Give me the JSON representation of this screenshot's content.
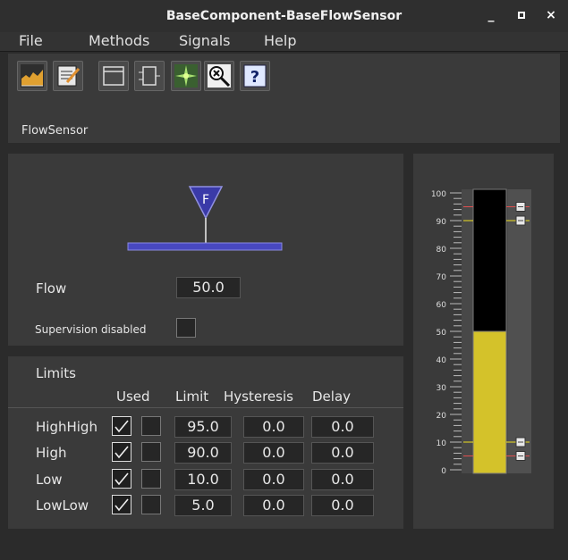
{
  "window": {
    "title": "BaseComponent-BaseFlowSensor",
    "minimize": "_",
    "close": "×"
  },
  "menu": [
    "File",
    "Methods",
    "Signals",
    "Help"
  ],
  "toolbar": {
    "buttons": [
      "trend-icon",
      "notes-icon",
      "window-icon",
      "component-icon",
      "crosshair-icon",
      "zoom-cancel-icon",
      "help-icon"
    ],
    "help_glyph": "?",
    "component_name": "FlowSensor"
  },
  "sensor": {
    "symbol_letter": "F",
    "flow_label": "Flow",
    "flow_value": "50.0",
    "supervision_label": "Supervision disabled",
    "supervision_checked": false
  },
  "limits": {
    "title": "Limits",
    "headers": {
      "used": "Used",
      "limit": "Limit",
      "hysteresis": "Hysteresis",
      "delay": "Delay"
    },
    "rows": [
      {
        "name": "HighHigh",
        "used": true,
        "limit": "95.0",
        "hysteresis": "0.0",
        "delay": "0.0"
      },
      {
        "name": "High",
        "used": true,
        "limit": "90.0",
        "hysteresis": "0.0",
        "delay": "0.0"
      },
      {
        "name": "Low",
        "used": true,
        "limit": "10.0",
        "hysteresis": "0.0",
        "delay": "0.0"
      },
      {
        "name": "LowLow",
        "used": true,
        "limit": "5.0",
        "hysteresis": "0.0",
        "delay": "0.0"
      }
    ]
  },
  "bar": {
    "value": 50,
    "min": 0,
    "max": 100,
    "ticks": [
      "100",
      "90",
      "80",
      "70",
      "60",
      "50",
      "40",
      "30",
      "20",
      "10",
      "0"
    ],
    "fill_color": "#d4c22a",
    "high_color": "#f0e020",
    "highhigh_color": "#e05050",
    "limits": {
      "highhigh": 95,
      "high": 90,
      "low": 10,
      "lowlow": 5
    }
  }
}
